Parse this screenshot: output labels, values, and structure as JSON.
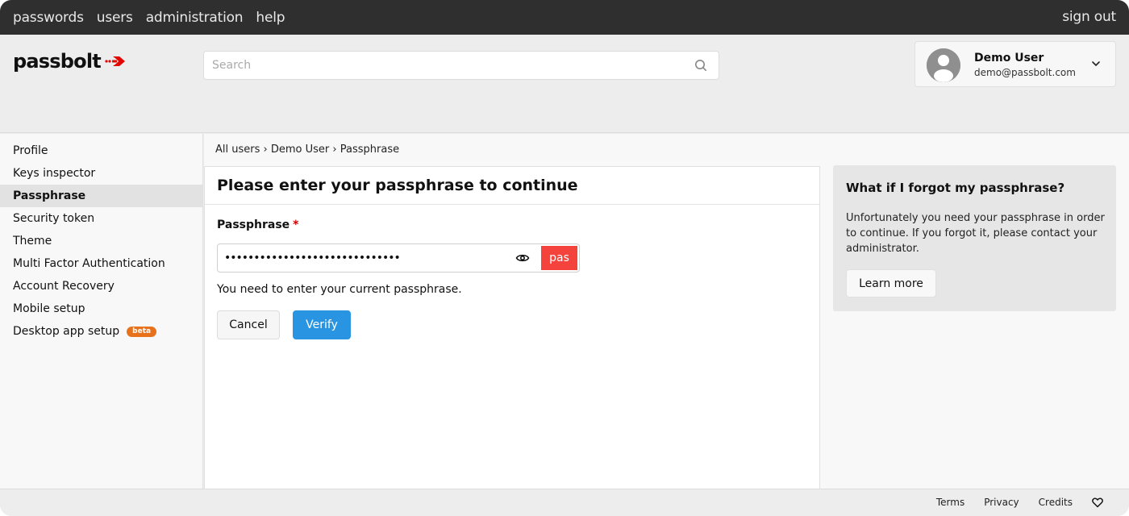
{
  "topnav": {
    "items": [
      "passwords",
      "users",
      "administration",
      "help"
    ],
    "sign_out": "sign out"
  },
  "header": {
    "logo_text": "passbolt",
    "search_placeholder": "Search",
    "search_value": "",
    "user": {
      "name": "Demo User",
      "email": "demo@passbolt.com"
    }
  },
  "sidebar": {
    "items": [
      {
        "label": "Profile",
        "active": false
      },
      {
        "label": "Keys inspector",
        "active": false
      },
      {
        "label": "Passphrase",
        "active": true
      },
      {
        "label": "Security token",
        "active": false
      },
      {
        "label": "Theme",
        "active": false
      },
      {
        "label": "Multi Factor Authentication",
        "active": false
      },
      {
        "label": "Account Recovery",
        "active": false
      },
      {
        "label": "Mobile setup",
        "active": false
      },
      {
        "label": "Desktop app setup",
        "active": false,
        "badge": "beta"
      }
    ]
  },
  "breadcrumb": {
    "items": [
      "All users",
      "Demo User",
      "Passphrase"
    ],
    "separator": "›"
  },
  "panel": {
    "title": "Please enter your passphrase to continue",
    "field_label": "Passphrase",
    "required_mark": "*",
    "passphrase_value": "••••••••••••••••••••••••••••••",
    "security_token": "pas",
    "help_text": "You need to enter your current passphrase.",
    "cancel_label": "Cancel",
    "verify_label": "Verify"
  },
  "help_box": {
    "title": "What if I forgot my passphrase?",
    "body": "Unfortunately you need your passphrase in order to continue. If you forgot it, please contact your administrator.",
    "learn_more_label": "Learn more"
  },
  "footer": {
    "links": [
      "Terms",
      "Privacy",
      "Credits"
    ]
  },
  "colors": {
    "topnav_bg": "#2f2f2f",
    "primary": "#2995e2",
    "security_token_bg": "#f4433c",
    "beta_badge": "#e8711c",
    "logo_accent": "#e10600"
  }
}
